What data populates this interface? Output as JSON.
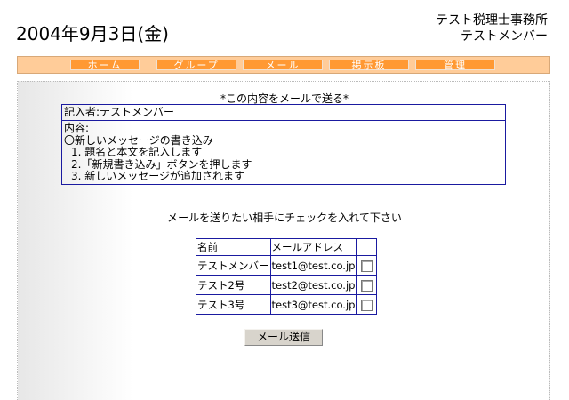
{
  "header": {
    "date": "2004年9月3日(金)",
    "office": "テスト税理士事務所",
    "user": "テストメンバー"
  },
  "nav": {
    "items": [
      {
        "label": "ホーム"
      },
      {
        "label": "グループ"
      },
      {
        "label": "メール"
      },
      {
        "label": "掲示板"
      },
      {
        "label": "管理"
      }
    ]
  },
  "main": {
    "section_title": "*この内容をメールで送る*",
    "author_label": "記入者:テストメンバー",
    "content_label": "内容:",
    "content_lines": [
      "〇新しいメッセージの書き込み",
      "1. 題名と本文を記入します",
      "2.「新規書き込み」ボタンを押します",
      "3. 新しいメッセージが追加されます"
    ],
    "instruction": "メールを送りたい相手にチェックを入れて下さい",
    "table": {
      "headers": [
        "名前",
        "メールアドレス",
        ""
      ],
      "rows": [
        {
          "name": "テストメンバー",
          "email": "test1@test.co.jp",
          "checked": false
        },
        {
          "name": "テスト2号",
          "email": "test2@test.co.jp",
          "checked": false
        },
        {
          "name": "テスト3号",
          "email": "test3@test.co.jp",
          "checked": false
        }
      ]
    },
    "send_button": "メール送信"
  },
  "colors": {
    "nav_bar": "#ffcc99",
    "nav_button": "#ff9933",
    "table_border": "#1a1aa0"
  }
}
